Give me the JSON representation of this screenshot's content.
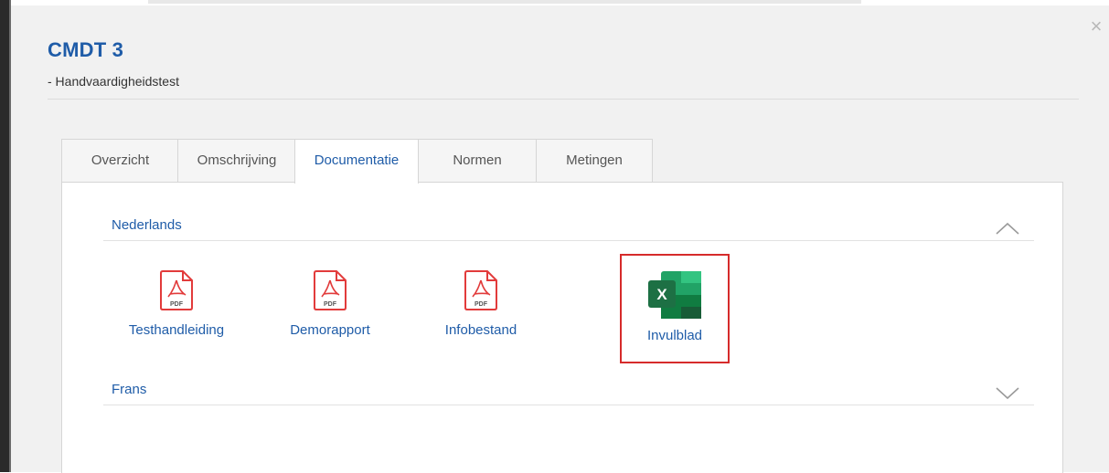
{
  "modal": {
    "title": "CMDT 3",
    "subtitle": "- Handvaardigheidstest",
    "close_glyph": "×"
  },
  "tabs": [
    {
      "label": "Overzicht",
      "active": false
    },
    {
      "label": "Omschrijving",
      "active": false
    },
    {
      "label": "Documentatie",
      "active": true
    },
    {
      "label": "Normen",
      "active": false
    },
    {
      "label": "Metingen",
      "active": false
    }
  ],
  "sections": [
    {
      "title": "Nederlands",
      "expanded": true,
      "chevron": "chevron-up-icon",
      "documents": [
        {
          "label": "Testhandleiding",
          "icon": "pdf-icon",
          "icon_text": "PDF"
        },
        {
          "label": "Demorapport",
          "icon": "pdf-icon",
          "icon_text": "PDF"
        },
        {
          "label": "Infobestand",
          "icon": "pdf-icon",
          "icon_text": "PDF"
        },
        {
          "label": "Invulblad",
          "icon": "excel-icon",
          "icon_text": "X",
          "highlighted": true
        }
      ]
    },
    {
      "title": "Frans",
      "expanded": false,
      "chevron": "chevron-down-icon"
    }
  ],
  "colors": {
    "accent": "#1f5ca8",
    "pdf_red": "#e23b3b",
    "excel_green": "#1d7044",
    "highlight_border": "#d62b2b"
  }
}
